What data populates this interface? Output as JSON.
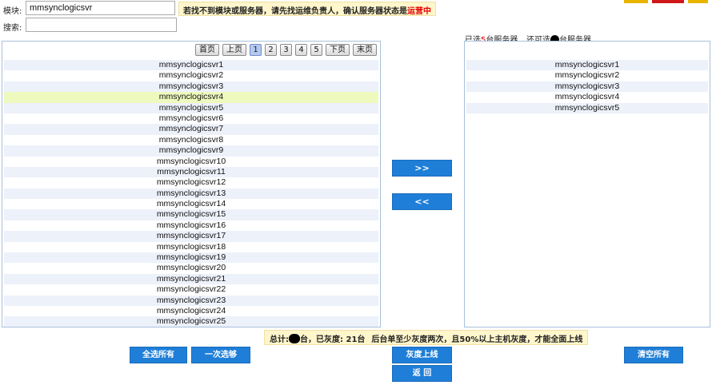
{
  "module": {
    "label": "模块:",
    "value": "mmsynclogicsvr"
  },
  "search": {
    "label": "搜索:",
    "value": ""
  },
  "hint": {
    "text": "若找不到模块或服务器，请先找运维负责人，确认服务器状态是",
    "status": "运营中"
  },
  "selected_info": {
    "prefix": "已选",
    "count": "5",
    "suffix": "台服务器",
    "available_prefix": "还可选",
    "available_suffix": "台服务器"
  },
  "pager": {
    "first": "首页",
    "prev": "上页",
    "pages": [
      "1",
      "2",
      "3",
      "4",
      "5"
    ],
    "active_page": "1",
    "next": "下页",
    "last": "末页"
  },
  "available_servers": [
    "mmsynclogicsvr1",
    "mmsynclogicsvr2",
    "mmsynclogicsvr3",
    "mmsynclogicsvr4",
    "mmsynclogicsvr5",
    "mmsynclogicsvr6",
    "mmsynclogicsvr7",
    "mmsynclogicsvr8",
    "mmsynclogicsvr9",
    "mmsynclogicsvr10",
    "mmsynclogicsvr11",
    "mmsynclogicsvr12",
    "mmsynclogicsvr13",
    "mmsynclogicsvr14",
    "mmsynclogicsvr15",
    "mmsynclogicsvr16",
    "mmsynclogicsvr17",
    "mmsynclogicsvr18",
    "mmsynclogicsvr19",
    "mmsynclogicsvr20",
    "mmsynclogicsvr21",
    "mmsynclogicsvr22",
    "mmsynclogicsvr23",
    "mmsynclogicsvr24",
    "mmsynclogicsvr25"
  ],
  "highlighted_server": "mmsynclogicsvr4",
  "selected_servers": [
    "mmsynclogicsvr1",
    "mmsynclogicsvr2",
    "mmsynclogicsvr3",
    "mmsynclogicsvr4",
    "mmsynclogicsvr5"
  ],
  "buttons": {
    "move_right": ">>",
    "move_left": "<<",
    "select_all": "全选所有",
    "select_once": "一次选够",
    "gray_release": "灰度上线",
    "back": "返 回",
    "clear_all": "清空所有"
  },
  "stats": {
    "total_prefix": "总计:",
    "total_suffix": "台，已灰度: 21台",
    "rule": "后台单至少灰度两次，且50%以上主机灰度，才能全面上线"
  },
  "colors": {
    "accent": "#1f7fd8",
    "highlight_row": "#eef9bd",
    "alt_row": "#edf1fa",
    "hint_bg": "#fff6cc",
    "status_red": "#e60000"
  }
}
